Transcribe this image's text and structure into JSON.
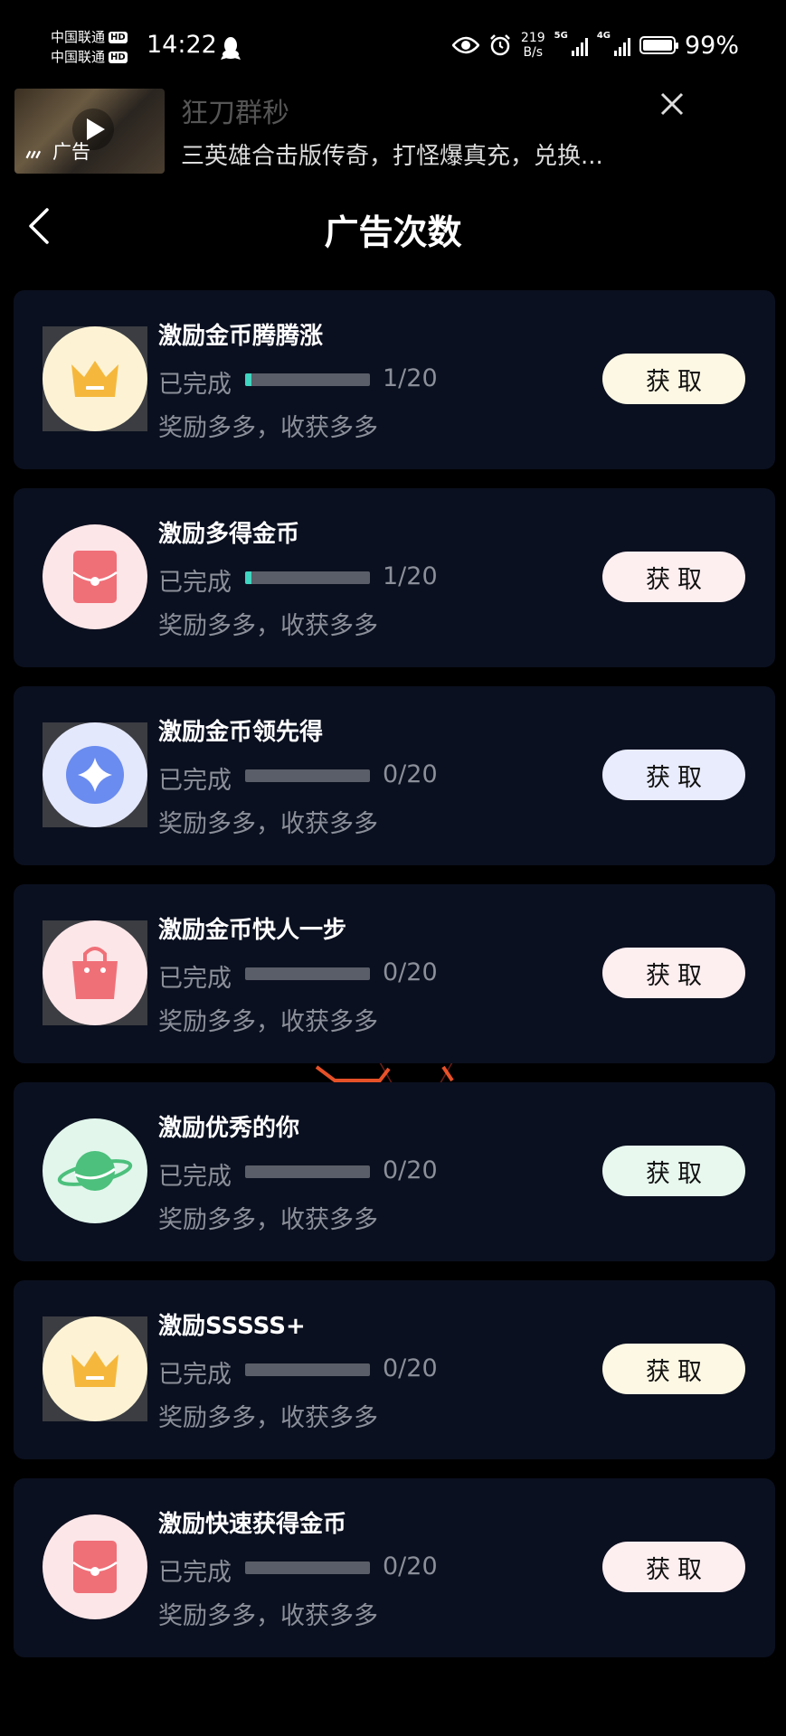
{
  "status_bar": {
    "carrier_1": "中国联通",
    "carrier_2": "中国联通",
    "hd_1": "HD",
    "hd_2": "HD",
    "time": "14:22",
    "speed_value": "219",
    "speed_unit": "B/s",
    "net_5g": "5G",
    "net_4g": "4G",
    "battery": "99%",
    "battery_level": 0.99
  },
  "ad": {
    "title": "狂刀群秒",
    "description": "三英雄合击版传奇，打怪爆真充，兑换...",
    "tag": "广告"
  },
  "header": {
    "title": "广告次数"
  },
  "tasks": [
    {
      "title": "激励金币腾腾涨",
      "done_label": "已完成",
      "count": "1/20",
      "progress": 0.05,
      "subtitle": "奖励多多，收获多多",
      "button": "获取",
      "icon": "crown-icon",
      "icon_bg": "#fdf3d4",
      "icon_color": "#f5b83d",
      "button_bg": "#fdf8e4"
    },
    {
      "title": "激励多得金币",
      "done_label": "已完成",
      "count": "1/20",
      "progress": 0.05,
      "subtitle": "奖励多多，收获多多",
      "button": "获取",
      "icon": "red-envelope-icon",
      "icon_bg": "#fde6e8",
      "icon_color": "#f07078",
      "button_bg": "#fdeef0"
    },
    {
      "title": "激励金币领先得",
      "done_label": "已完成",
      "count": "0/20",
      "progress": 0,
      "subtitle": "奖励多多，收获多多",
      "button": "获取",
      "icon": "diamond-coin-icon",
      "icon_bg": "#e4e8fc",
      "icon_color": "#6a8cf0",
      "button_bg": "#e9ecfc"
    },
    {
      "title": "激励金币快人一步",
      "done_label": "已完成",
      "count": "0/20",
      "progress": 0,
      "subtitle": "奖励多多，收获多多",
      "button": "获取",
      "icon": "shopping-bag-icon",
      "icon_bg": "#fde6e8",
      "icon_color": "#f07078",
      "button_bg": "#fdeef0"
    },
    {
      "title": "激励优秀的你",
      "done_label": "已完成",
      "count": "0/20",
      "progress": 0,
      "subtitle": "奖励多多，收获多多",
      "button": "获取",
      "icon": "planet-icon",
      "icon_bg": "#e2f6ec",
      "icon_color": "#4cc07c",
      "button_bg": "#e8f8ef"
    },
    {
      "title": "激励SSSSS+",
      "done_label": "已完成",
      "count": "0/20",
      "progress": 0,
      "subtitle": "奖励多多，收获多多",
      "button": "获取",
      "icon": "crown-icon",
      "icon_bg": "#fdf3d4",
      "icon_color": "#f5b83d",
      "button_bg": "#fdf8e4"
    },
    {
      "title": "激励快速获得金币",
      "done_label": "已完成",
      "count": "0/20",
      "progress": 0,
      "subtitle": "奖励多多，收获多多",
      "button": "获取",
      "icon": "red-envelope-icon",
      "icon_bg": "#fde6e8",
      "icon_color": "#f07078",
      "button_bg": "#fdeef0"
    }
  ],
  "colors": {
    "background": "#000000",
    "card": "#0b1020",
    "progress_fill": "#3fd5c0",
    "progress_track": "#5a5e68",
    "muted_text": "#8b8f99"
  }
}
